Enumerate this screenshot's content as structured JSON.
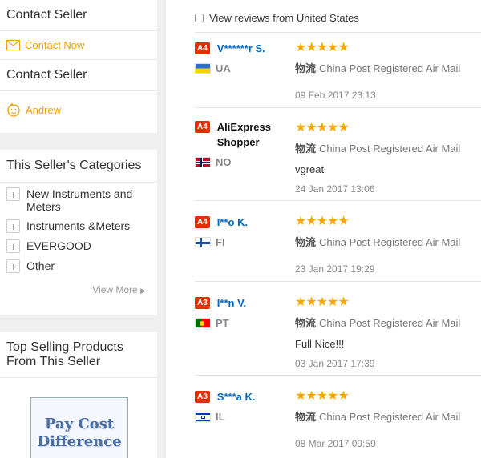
{
  "sidebar": {
    "contact_title_1": "Contact Seller",
    "contact_now": "Contact Now",
    "contact_title_2": "Contact Seller",
    "seller_name": "Andrew",
    "categories_title": "This Seller's Categories",
    "categories": [
      "New Instruments and Meters",
      "Instruments &Meters",
      "EVERGOOD",
      "Other"
    ],
    "view_more": "View More",
    "top_selling_title": "Top Selling Products From This Seller",
    "product_image_text": "Pay Cost Difference"
  },
  "filter": {
    "label": "View reviews from United States"
  },
  "reviews": [
    {
      "badge": "A4",
      "name": "V******r S.",
      "country": "UA",
      "stars": "★★★★★",
      "logistics_label": "物流",
      "logistics": "China Post Registered Air Mail",
      "feedback": "",
      "date": "09 Feb 2017 23:13"
    },
    {
      "badge": "A4",
      "name": "AliExpress Shopper",
      "country": "NO",
      "stars": "★★★★★",
      "logistics_label": "物流",
      "logistics": "China Post Registered Air Mail",
      "feedback": "vgreat",
      "date": "24 Jan 2017 13:06"
    },
    {
      "badge": "A4",
      "name": "I**o K.",
      "country": "FI",
      "stars": "★★★★★",
      "logistics_label": "物流",
      "logistics": "China Post Registered Air Mail",
      "feedback": "",
      "date": "23 Jan 2017 19:29"
    },
    {
      "badge": "A3",
      "name": "I**n V.",
      "country": "PT",
      "stars": "★★★★★",
      "logistics_label": "物流",
      "logistics": "China Post Registered Air Mail",
      "feedback": "Full Nice!!!",
      "date": "03 Jan 2017 17:39"
    },
    {
      "badge": "A3",
      "name": "S***a K.",
      "country": "IL",
      "stars": "★★★★★",
      "logistics_label": "物流",
      "logistics": "China Post Registered Air Mail",
      "feedback": "",
      "date": "08 Mar 2017 09:59"
    }
  ],
  "colors": {
    "accent": "#f0a000",
    "link": "#0068c4",
    "badge": "#e62e04",
    "star": "#f7a800"
  }
}
